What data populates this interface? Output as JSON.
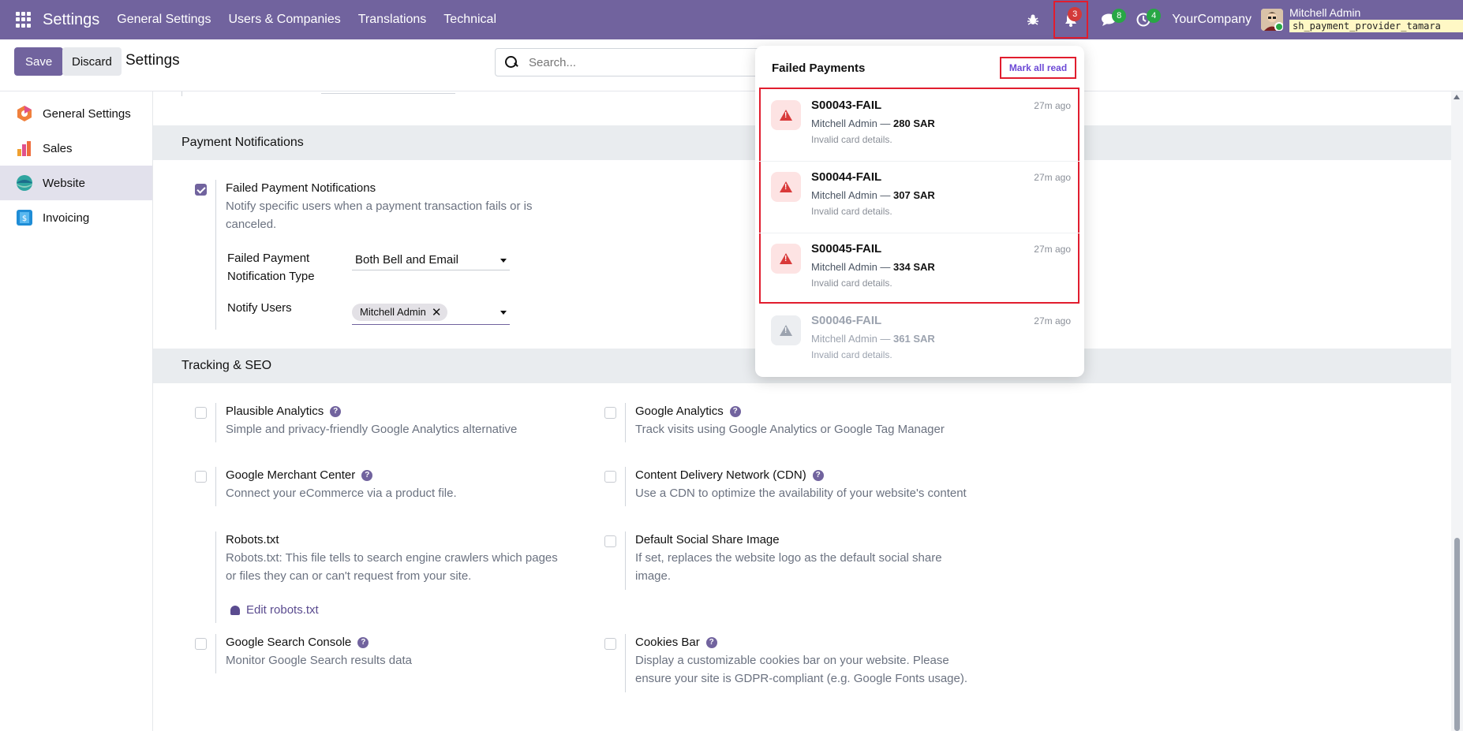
{
  "topbar": {
    "app_title": "Settings",
    "menu": [
      "General Settings",
      "Users & Companies",
      "Translations",
      "Technical"
    ],
    "notifications_count": "3",
    "messages_count": "8",
    "activities_count": "4",
    "company": "YourCompany",
    "user_name": "Mitchell Admin",
    "db_name": "sh_payment_provider_tamara"
  },
  "controlpanel": {
    "save_label": "Save",
    "discard_label": "Discard",
    "title": "Settings",
    "search_placeholder": "Search..."
  },
  "sidebar": {
    "items": [
      {
        "label": "General Settings",
        "icon": "odoo-icon"
      },
      {
        "label": "Sales",
        "icon": "sales-icon"
      },
      {
        "label": "Website",
        "icon": "website-icon",
        "active": true
      },
      {
        "label": "Invoicing",
        "icon": "invoicing-icon"
      }
    ]
  },
  "payment_notifications": {
    "section_title": "Payment Notifications",
    "setting_title": "Failed Payment Notifications",
    "setting_desc_1": "Notify specific users when a payment transaction fails or is",
    "setting_desc_2": "canceled.",
    "checked": true,
    "type_label_1": "Failed Payment",
    "type_label_2": "Notification Type",
    "type_value": "Both Bell and Email",
    "users_label": "Notify Users",
    "users_tag": "Mitchell Admin"
  },
  "tracking": {
    "section_title": "Tracking & SEO",
    "settings": [
      {
        "title": "Plausible Analytics",
        "desc": [
          "Simple and privacy-friendly Google Analytics alternative"
        ]
      },
      {
        "title": "Google Analytics",
        "desc": [
          "Track visits using Google Analytics or Google Tag Manager"
        ]
      },
      {
        "title": "Google Merchant Center",
        "desc": [
          "Connect your eCommerce via a product file."
        ]
      },
      {
        "title": "Content Delivery Network (CDN)",
        "desc": [
          "Use a CDN to optimize the availability of your website's content"
        ]
      },
      {
        "title": "Robots.txt",
        "desc": [
          "Robots.txt: This file tells to search engine crawlers which pages",
          "or files they can or can't request from your site."
        ],
        "link": "Edit robots.txt"
      },
      {
        "title": "Default Social Share Image",
        "desc": [
          "If set, replaces the website logo as the default social share",
          "image."
        ]
      },
      {
        "title": "Google Search Console",
        "desc": [
          "Monitor Google Search results data"
        ]
      },
      {
        "title": "Cookies Bar",
        "desc": [
          "Display a customizable cookies bar on your website. Please",
          "ensure your site is GDPR-compliant (e.g. Google Fonts usage)."
        ]
      }
    ]
  },
  "dropdown": {
    "title": "Failed Payments",
    "mark_all_read": "Mark all read",
    "items": [
      {
        "ref": "S00043-FAIL",
        "time": "27m ago",
        "who": "Mitchell Admin — ",
        "amount": "280 SAR",
        "reason": "Invalid card details.",
        "unread": true
      },
      {
        "ref": "S00044-FAIL",
        "time": "27m ago",
        "who": "Mitchell Admin — ",
        "amount": "307 SAR",
        "reason": "Invalid card details.",
        "unread": true
      },
      {
        "ref": "S00045-FAIL",
        "time": "27m ago",
        "who": "Mitchell Admin — ",
        "amount": "334 SAR",
        "reason": "Invalid card details.",
        "unread": true
      },
      {
        "ref": "S00046-FAIL",
        "time": "27m ago",
        "who": "Mitchell Admin — ",
        "amount": "361 SAR",
        "reason": "Invalid card details.",
        "unread": false
      }
    ]
  },
  "colors": {
    "brand": "#71639e",
    "highlight_border": "#e11d2e",
    "unread_icon_bg": "#fde3e3"
  }
}
